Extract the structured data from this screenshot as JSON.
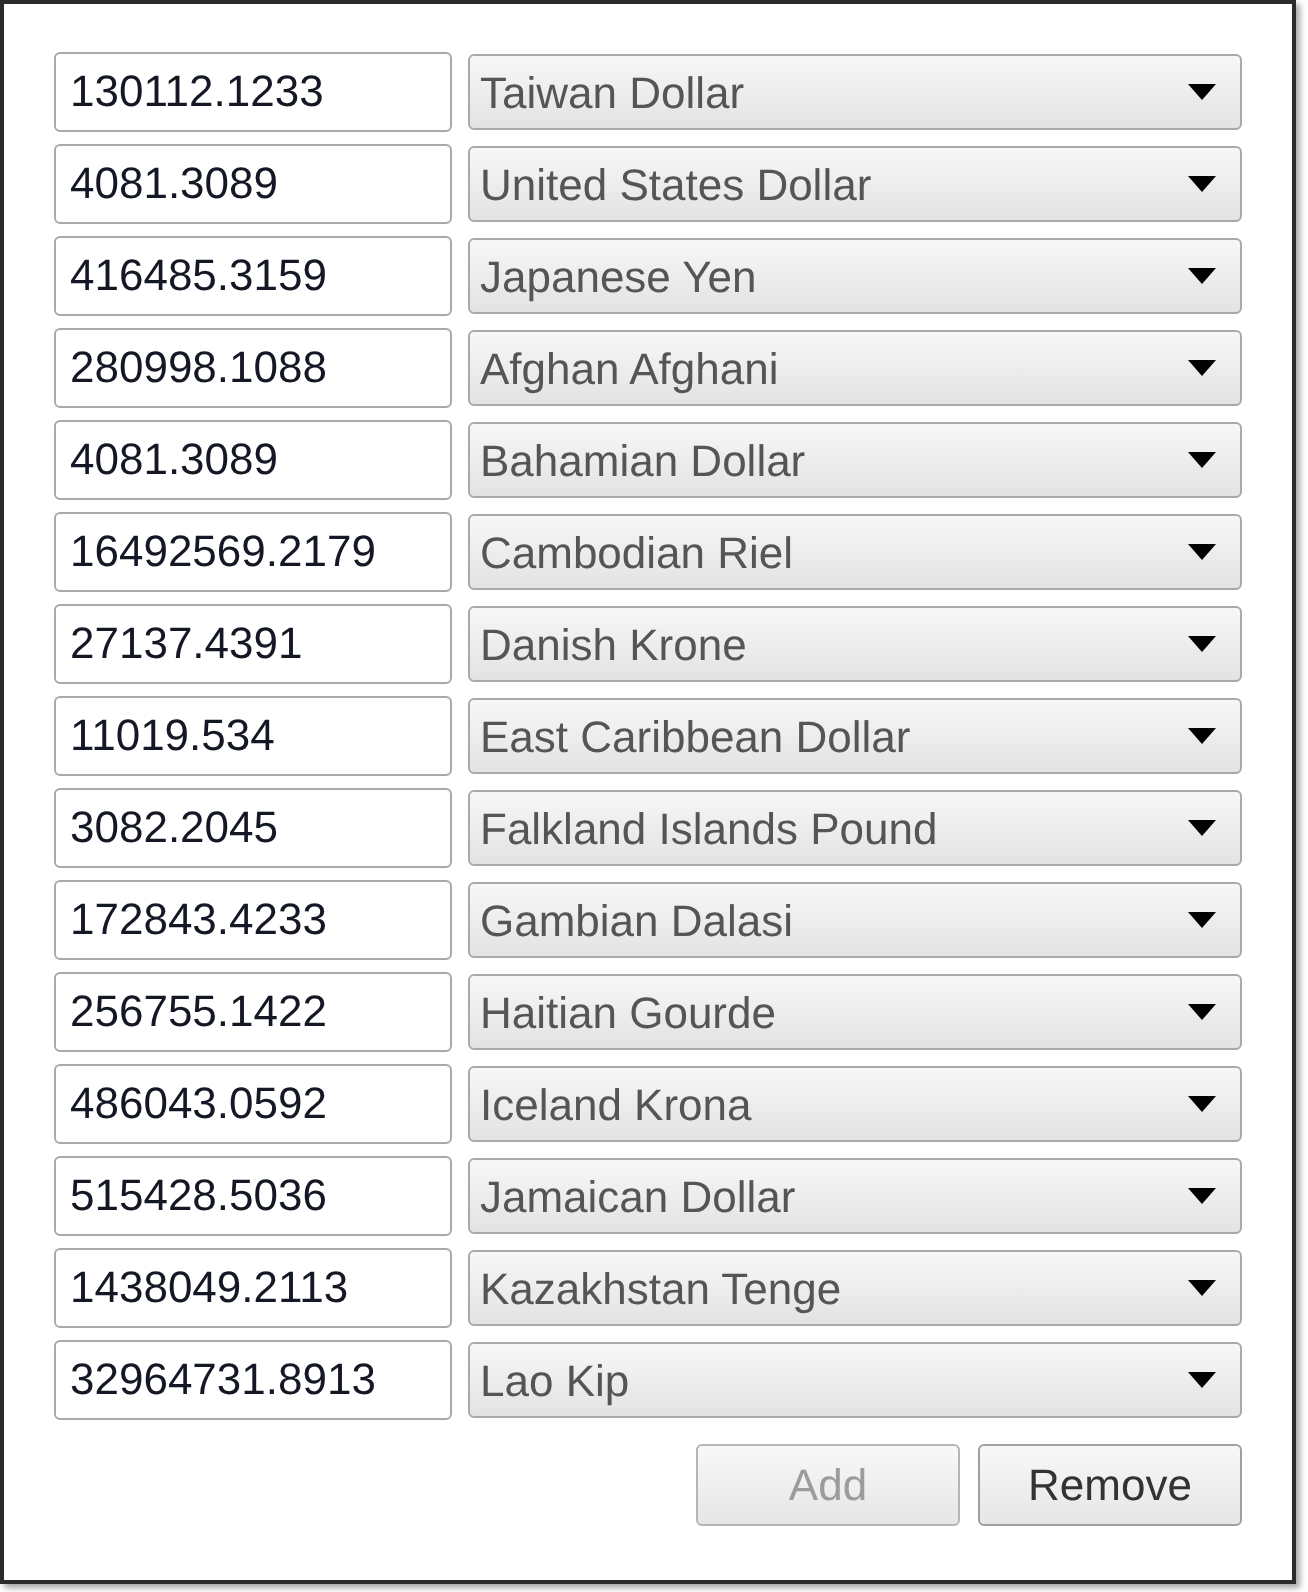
{
  "rows": [
    {
      "amount": "130112.1233",
      "currency": "Taiwan Dollar"
    },
    {
      "amount": "4081.3089",
      "currency": "United States Dollar"
    },
    {
      "amount": "416485.3159",
      "currency": "Japanese Yen"
    },
    {
      "amount": "280998.1088",
      "currency": "Afghan Afghani"
    },
    {
      "amount": "4081.3089",
      "currency": "Bahamian Dollar"
    },
    {
      "amount": "16492569.2179",
      "currency": "Cambodian Riel"
    },
    {
      "amount": "27137.4391",
      "currency": "Danish Krone"
    },
    {
      "amount": "11019.534",
      "currency": "East Caribbean Dollar"
    },
    {
      "amount": "3082.2045",
      "currency": "Falkland Islands Pound"
    },
    {
      "amount": "172843.4233",
      "currency": "Gambian Dalasi"
    },
    {
      "amount": "256755.1422",
      "currency": "Haitian Gourde"
    },
    {
      "amount": "486043.0592",
      "currency": "Iceland Krona"
    },
    {
      "amount": "515428.5036",
      "currency": "Jamaican Dollar"
    },
    {
      "amount": "1438049.2113",
      "currency": "Kazakhstan Tenge"
    },
    {
      "amount": "32964731.8913",
      "currency": "Lao Kip"
    }
  ],
  "buttons": [
    {
      "label": "Add",
      "disabled": true
    },
    {
      "label": "Remove",
      "disabled": false
    }
  ]
}
